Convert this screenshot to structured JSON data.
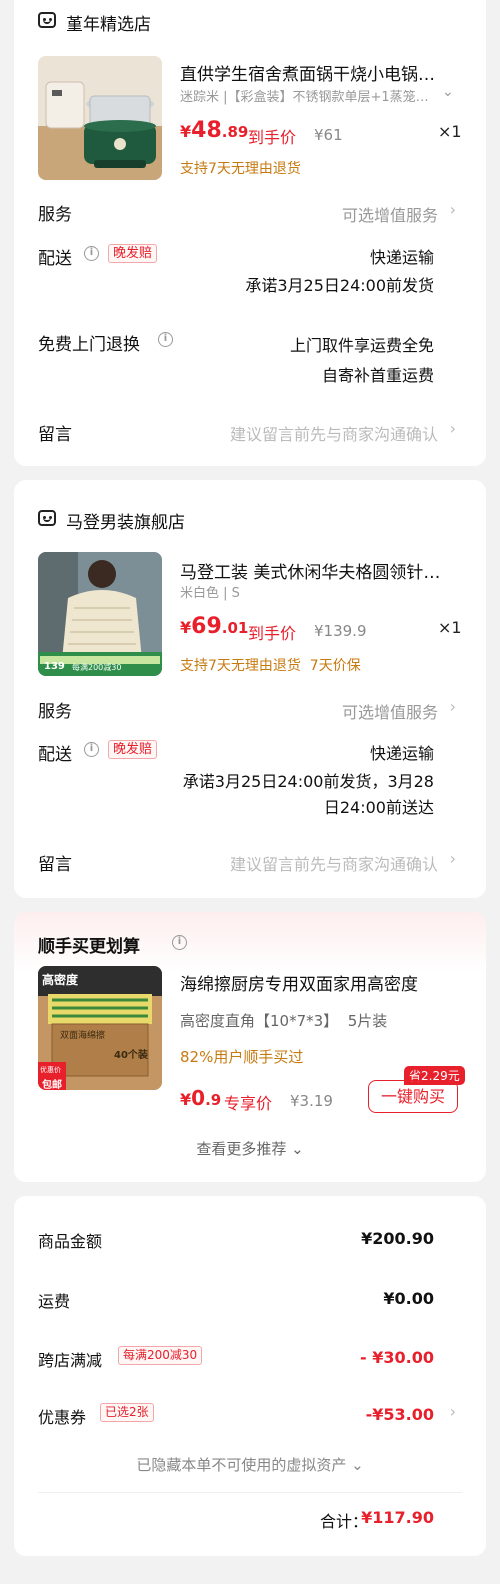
{
  "stores": [
    {
      "name": "堇年精选店",
      "product": {
        "title": "直供学生宿舍煮面锅干烧小电锅…",
        "spec": "迷踪米 |【彩盒装】不锈钢款单层+1蒸笼…",
        "price_cur": "¥",
        "price_int": "48",
        "price_dec": ".89",
        "price_tag": "到手价",
        "orig_price": "¥61",
        "qty": "×1",
        "policy": "支持7天无理由退货"
      },
      "service_label": "服务",
      "service_value": "可选增值服务",
      "delivery_label": "配送",
      "delivery_badge": "晚发赔",
      "delivery_method": "快递运输",
      "delivery_promise_1": "承诺3月25日24:00前发货",
      "return_label": "免费上门退换",
      "return_value_1": "上门取件享运费全免",
      "return_value_2": "自寄补首重运费",
      "message_label": "留言",
      "message_placeholder": "建议留言前先与商家沟通确认"
    },
    {
      "name": "马登男装旗舰店",
      "product": {
        "title": "马登工装 美式休闲华夫格圆领针…",
        "spec": "米白色 | S",
        "price_cur": "¥",
        "price_int": "69",
        "price_dec": ".01",
        "price_tag": "到手价",
        "orig_price": "¥139.9",
        "qty": "×1",
        "policy": "支持7天无理由退货  7天价保",
        "img_price": "139",
        "img_promo": "每满200减30"
      },
      "service_label": "服务",
      "service_value": "可选增值服务",
      "delivery_label": "配送",
      "delivery_badge": "晚发赔",
      "delivery_method": "快递运输",
      "delivery_promise_1": "承诺3月25日24:00前发货，3月28",
      "delivery_promise_2": "日24:00前送达",
      "message_label": "留言",
      "message_placeholder": "建议留言前先与商家沟通确认"
    }
  ],
  "recommend": {
    "title": "顺手买更划算",
    "product_title": "海绵擦厨房专用双面家用高密度",
    "spec": "高密度直角【10*7*3】  5片装",
    "stat": "82%用户顺手买过",
    "price_cur": "¥",
    "price_int": "0",
    "price_dec": ".9",
    "price_tag": "专享价",
    "orig_price": "¥3.19",
    "save_badge": "省2.29元",
    "buy_button": "一键购买",
    "more": "查看更多推荐",
    "img_label_1": "高密度",
    "img_label_2": "40个装",
    "img_label_3": "双面海绵擦",
    "img_badge_1": "优惠价",
    "img_badge_2": "包邮"
  },
  "summary": {
    "goods_label": "商品金额",
    "goods_value": "¥200.90",
    "shipping_label": "运费",
    "shipping_value": "¥0.00",
    "cross_label": "跨店满减",
    "cross_badge": "每满200减30",
    "cross_value": "- ¥30.00",
    "coupon_label": "优惠券",
    "coupon_badge": "已选2张",
    "coupon_value": "-¥53.00",
    "hidden_note": "已隐藏本单不可使用的虚拟资产",
    "total_label": "合计：",
    "total_value": "¥117.90"
  },
  "colors": {
    "accent": "#e8202b",
    "policy": "#c77a10",
    "bg": "#f2f2f2"
  },
  "icons": [
    "store-icon",
    "info-icon",
    "chevron-right-icon",
    "chevron-down-icon"
  ]
}
